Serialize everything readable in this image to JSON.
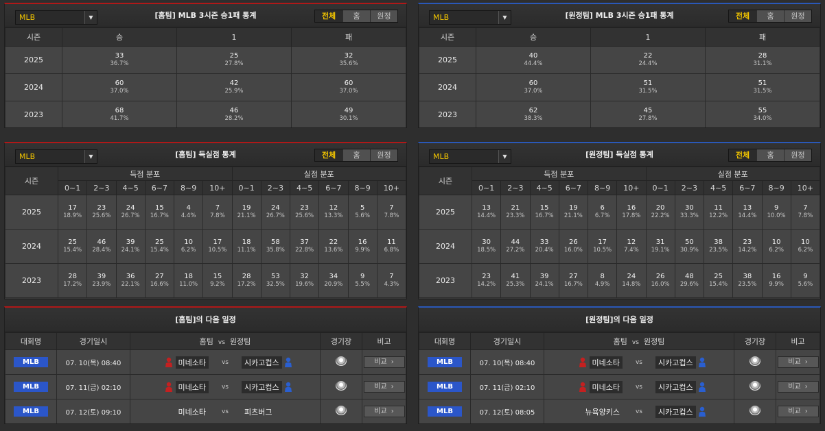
{
  "common": {
    "league_select": "MLB",
    "tabs": [
      "전체",
      "홈",
      "원정"
    ],
    "season_label": "시즌",
    "bins": [
      "0~1",
      "2~3",
      "4~5",
      "6~7",
      "8~9",
      "10+"
    ]
  },
  "home": {
    "record": {
      "title": "[홈팀] MLB 3시즌 승1패 통계",
      "headers": [
        "승",
        "1",
        "패"
      ],
      "rows": [
        {
          "season": "2025",
          "cells": [
            {
              "v": "33",
              "p": "36.7%"
            },
            {
              "v": "25",
              "p": "27.8%"
            },
            {
              "v": "32",
              "p": "35.6%"
            }
          ]
        },
        {
          "season": "2024",
          "cells": [
            {
              "v": "60",
              "p": "37.0%"
            },
            {
              "v": "42",
              "p": "25.9%"
            },
            {
              "v": "60",
              "p": "37.0%"
            }
          ]
        },
        {
          "season": "2023",
          "cells": [
            {
              "v": "68",
              "p": "41.7%"
            },
            {
              "v": "46",
              "p": "28.2%"
            },
            {
              "v": "49",
              "p": "30.1%"
            }
          ]
        }
      ]
    },
    "score": {
      "title": "[홈팀] 득실점 통계",
      "scored_label": "득점 분포",
      "conceded_label": "실점 분포",
      "rows": [
        {
          "season": "2025",
          "cells": [
            {
              "v": "17",
              "p": "18.9%"
            },
            {
              "v": "23",
              "p": "25.6%"
            },
            {
              "v": "24",
              "p": "26.7%"
            },
            {
              "v": "15",
              "p": "16.7%"
            },
            {
              "v": "4",
              "p": "4.4%"
            },
            {
              "v": "7",
              "p": "7.8%"
            },
            {
              "v": "19",
              "p": "21.1%"
            },
            {
              "v": "24",
              "p": "26.7%"
            },
            {
              "v": "23",
              "p": "25.6%"
            },
            {
              "v": "12",
              "p": "13.3%"
            },
            {
              "v": "5",
              "p": "5.6%"
            },
            {
              "v": "7",
              "p": "7.8%"
            }
          ]
        },
        {
          "season": "2024",
          "cells": [
            {
              "v": "25",
              "p": "15.4%"
            },
            {
              "v": "46",
              "p": "28.4%"
            },
            {
              "v": "39",
              "p": "24.1%"
            },
            {
              "v": "25",
              "p": "15.4%"
            },
            {
              "v": "10",
              "p": "6.2%"
            },
            {
              "v": "17",
              "p": "10.5%"
            },
            {
              "v": "18",
              "p": "11.1%"
            },
            {
              "v": "58",
              "p": "35.8%"
            },
            {
              "v": "37",
              "p": "22.8%"
            },
            {
              "v": "22",
              "p": "13.6%"
            },
            {
              "v": "16",
              "p": "9.9%"
            },
            {
              "v": "11",
              "p": "6.8%"
            }
          ]
        },
        {
          "season": "2023",
          "cells": [
            {
              "v": "28",
              "p": "17.2%"
            },
            {
              "v": "39",
              "p": "23.9%"
            },
            {
              "v": "36",
              "p": "22.1%"
            },
            {
              "v": "27",
              "p": "16.6%"
            },
            {
              "v": "18",
              "p": "11.0%"
            },
            {
              "v": "15",
              "p": "9.2%"
            },
            {
              "v": "28",
              "p": "17.2%"
            },
            {
              "v": "53",
              "p": "32.5%"
            },
            {
              "v": "32",
              "p": "19.6%"
            },
            {
              "v": "34",
              "p": "20.9%"
            },
            {
              "v": "9",
              "p": "5.5%"
            },
            {
              "v": "7",
              "p": "4.3%"
            }
          ]
        }
      ]
    },
    "schedule": {
      "title": "[홈팀]의 다음 일정",
      "headers": {
        "league": "대회명",
        "date": "경기일시",
        "home": "홈팀",
        "vs": "vs",
        "away": "원정팀",
        "venue": "경기장",
        "note": "비고"
      },
      "compare_label": "비교",
      "rows": [
        {
          "league": "MLB",
          "date": "07. 10(목) 08:40",
          "home": "미네소타",
          "away": "시카고컵스",
          "home_icon": true,
          "away_icon": true
        },
        {
          "league": "MLB",
          "date": "07. 11(금) 02:10",
          "home": "미네소타",
          "away": "시카고컵스",
          "home_icon": true,
          "away_icon": true
        },
        {
          "league": "MLB",
          "date": "07. 12(토) 09:10",
          "home": "미네소타",
          "away": "피츠버그",
          "home_icon": false,
          "away_icon": false
        }
      ]
    }
  },
  "away": {
    "record": {
      "title": "[원정팀] MLB 3시즌 승1패 통계",
      "headers": [
        "승",
        "1",
        "패"
      ],
      "rows": [
        {
          "season": "2025",
          "cells": [
            {
              "v": "40",
              "p": "44.4%"
            },
            {
              "v": "22",
              "p": "24.4%"
            },
            {
              "v": "28",
              "p": "31.1%"
            }
          ]
        },
        {
          "season": "2024",
          "cells": [
            {
              "v": "60",
              "p": "37.0%"
            },
            {
              "v": "51",
              "p": "31.5%"
            },
            {
              "v": "51",
              "p": "31.5%"
            }
          ]
        },
        {
          "season": "2023",
          "cells": [
            {
              "v": "62",
              "p": "38.3%"
            },
            {
              "v": "45",
              "p": "27.8%"
            },
            {
              "v": "55",
              "p": "34.0%"
            }
          ]
        }
      ]
    },
    "score": {
      "title": "[원정팀] 득실점 통계",
      "scored_label": "득점 분포",
      "conceded_label": "실점 분포",
      "rows": [
        {
          "season": "2025",
          "cells": [
            {
              "v": "13",
              "p": "14.4%"
            },
            {
              "v": "21",
              "p": "23.3%"
            },
            {
              "v": "15",
              "p": "16.7%"
            },
            {
              "v": "19",
              "p": "21.1%"
            },
            {
              "v": "6",
              "p": "6.7%"
            },
            {
              "v": "16",
              "p": "17.8%"
            },
            {
              "v": "20",
              "p": "22.2%"
            },
            {
              "v": "30",
              "p": "33.3%"
            },
            {
              "v": "11",
              "p": "12.2%"
            },
            {
              "v": "13",
              "p": "14.4%"
            },
            {
              "v": "9",
              "p": "10.0%"
            },
            {
              "v": "7",
              "p": "7.8%"
            }
          ]
        },
        {
          "season": "2024",
          "cells": [
            {
              "v": "30",
              "p": "18.5%"
            },
            {
              "v": "44",
              "p": "27.2%"
            },
            {
              "v": "33",
              "p": "20.4%"
            },
            {
              "v": "26",
              "p": "16.0%"
            },
            {
              "v": "17",
              "p": "10.5%"
            },
            {
              "v": "12",
              "p": "7.4%"
            },
            {
              "v": "31",
              "p": "19.1%"
            },
            {
              "v": "50",
              "p": "30.9%"
            },
            {
              "v": "38",
              "p": "23.5%"
            },
            {
              "v": "23",
              "p": "14.2%"
            },
            {
              "v": "10",
              "p": "6.2%"
            },
            {
              "v": "10",
              "p": "6.2%"
            }
          ]
        },
        {
          "season": "2023",
          "cells": [
            {
              "v": "23",
              "p": "14.2%"
            },
            {
              "v": "41",
              "p": "25.3%"
            },
            {
              "v": "39",
              "p": "24.1%"
            },
            {
              "v": "27",
              "p": "16.7%"
            },
            {
              "v": "8",
              "p": "4.9%"
            },
            {
              "v": "24",
              "p": "14.8%"
            },
            {
              "v": "26",
              "p": "16.0%"
            },
            {
              "v": "48",
              "p": "29.6%"
            },
            {
              "v": "25",
              "p": "15.4%"
            },
            {
              "v": "38",
              "p": "23.5%"
            },
            {
              "v": "16",
              "p": "9.9%"
            },
            {
              "v": "9",
              "p": "5.6%"
            }
          ]
        }
      ]
    },
    "schedule": {
      "title": "[원정팀]의 다음 일정",
      "headers": {
        "league": "대회명",
        "date": "경기일시",
        "home": "홈팀",
        "vs": "vs",
        "away": "원정팀",
        "venue": "경기장",
        "note": "비고"
      },
      "compare_label": "비교",
      "rows": [
        {
          "league": "MLB",
          "date": "07. 10(목) 08:40",
          "home": "미네소타",
          "away": "시카고컵스",
          "home_icon": true,
          "away_icon": true
        },
        {
          "league": "MLB",
          "date": "07. 11(금) 02:10",
          "home": "미네소타",
          "away": "시카고컵스",
          "home_icon": true,
          "away_icon": true
        },
        {
          "league": "MLB",
          "date": "07. 12(토) 08:05",
          "home": "뉴욕양키스",
          "away": "시카고컵스",
          "home_icon": false,
          "away_icon": true
        }
      ]
    },
    "colors": {
      "home_accent": "#b01818",
      "away_accent": "#2a58b8",
      "active_tab": "#f2c500",
      "league_badge": "#2b56c9"
    }
  }
}
